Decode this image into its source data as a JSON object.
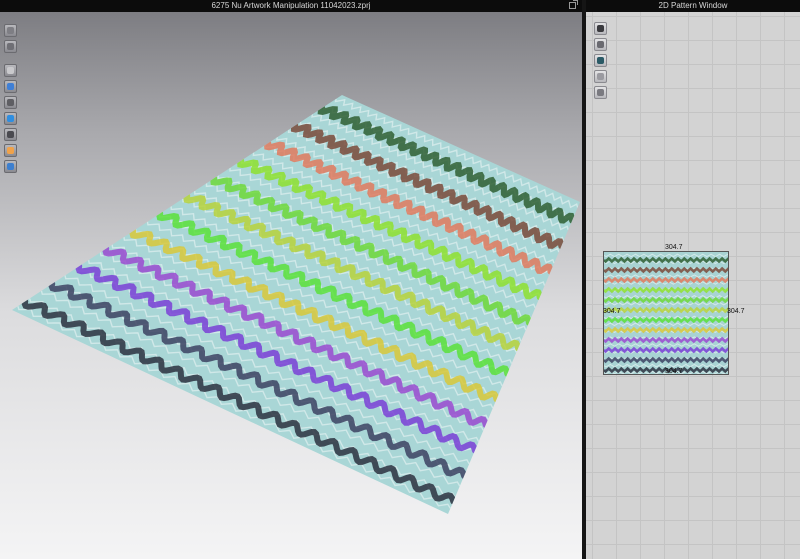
{
  "window3d": {
    "title": "6275 Nu Artwork Manipulation 11042023.zprj",
    "tools_top": [
      {
        "name": "avatar-display-icon",
        "color": "#7e7e84"
      },
      {
        "name": "garment-display-icon",
        "color": "#6f6f75"
      }
    ],
    "tools_main": [
      {
        "name": "texture-edit-icon",
        "color": "#c9c9cc"
      },
      {
        "name": "brush-icon",
        "color": "#3f7fd6"
      },
      {
        "name": "pin-tool-icon",
        "color": "#5e5e63"
      },
      {
        "name": "fold-tool-icon",
        "color": "#2f8ee0"
      },
      {
        "name": "cut-tool-icon",
        "color": "#4a4a50"
      },
      {
        "name": "avatar-skin-icon",
        "color": "#f0a24a"
      },
      {
        "name": "xray-icon",
        "color": "#3d7fcf"
      }
    ]
  },
  "window2d": {
    "title": "2D Pattern Window",
    "tools": [
      {
        "name": "edit-pattern-icon",
        "color": "#3a3a3e"
      },
      {
        "name": "transform-icon",
        "color": "#6a6a70"
      },
      {
        "name": "edit-texture-icon",
        "color": "#2a5a66"
      },
      {
        "name": "trace-icon",
        "color": "#9a9aa0"
      },
      {
        "name": "lock-icon",
        "color": "#7a7a80"
      }
    ],
    "dimensions": {
      "top": "304.7",
      "left": "304.7",
      "right": "304.7",
      "bottom": "304.7"
    }
  },
  "stripes": [
    {
      "color": "#2f5f33"
    },
    {
      "color": "#7a4a3a"
    },
    {
      "color": "#e07a5e"
    },
    {
      "color": "#8ee02f"
    },
    {
      "color": "#6fd83a"
    },
    {
      "color": "#b7d23c"
    },
    {
      "color": "#5ae03a"
    },
    {
      "color": "#d8c83a"
    },
    {
      "color": "#9a4ad0"
    },
    {
      "color": "#7a3fd6"
    },
    {
      "color": "#3c4262"
    },
    {
      "color": "#2b3140"
    }
  ],
  "fabric_color": "#a9d6d6"
}
